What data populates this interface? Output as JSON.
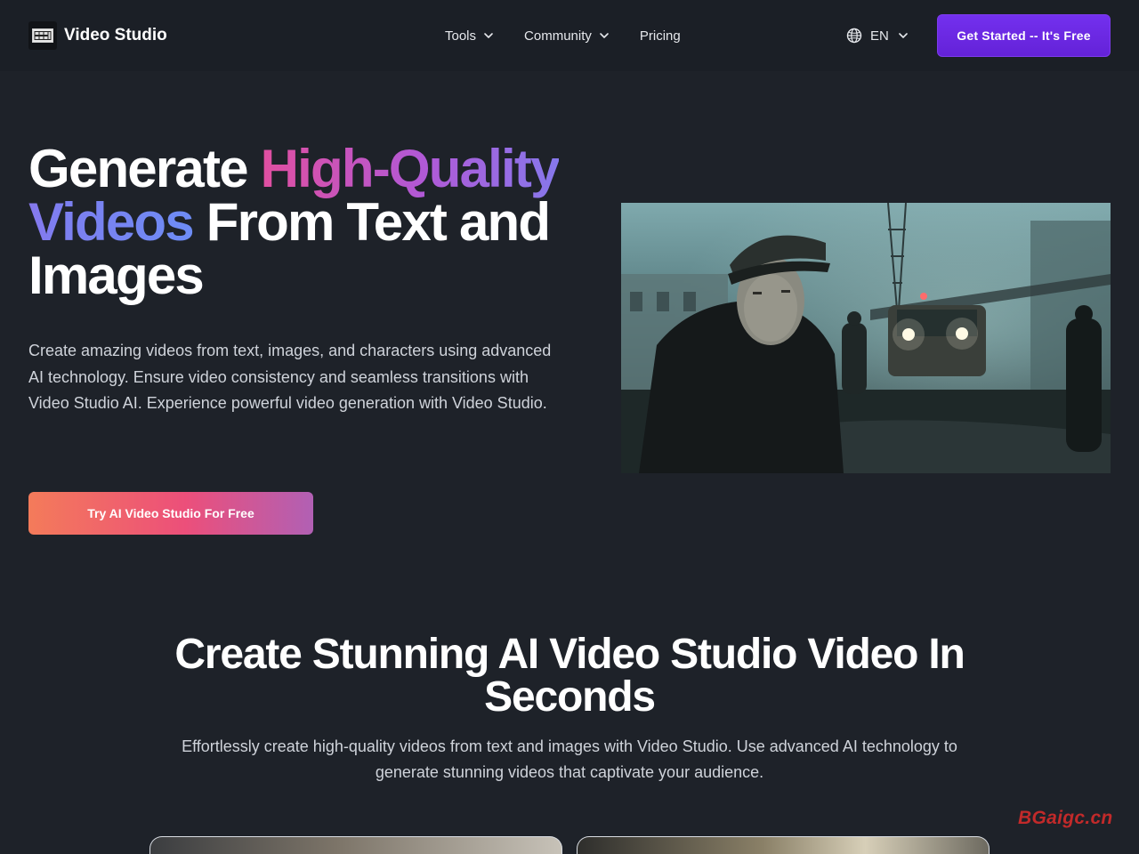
{
  "header": {
    "brand": {
      "name": "Video Studio",
      "logo_icon": "film-logo-icon"
    },
    "nav": [
      {
        "label": "Tools",
        "has_dropdown": true
      },
      {
        "label": "Community",
        "has_dropdown": true
      },
      {
        "label": "Pricing",
        "has_dropdown": false
      }
    ],
    "language": {
      "label": "EN",
      "icon": "globe-icon"
    },
    "cta_label": "Get Started -- It's Free"
  },
  "hero": {
    "title_part1": "Generate ",
    "title_highlight": "High-Quality Videos",
    "title_part2": " From Text and Images",
    "description": "Create amazing videos from text, images, and characters using advanced AI technology. Ensure video consistency and seamless transitions with Video Studio AI. Experience powerful video generation with Video Studio.",
    "cta_label": "Try AI Video Studio For Free"
  },
  "section": {
    "title": "Create Stunning AI Video Studio Video In Seconds",
    "description": "Effortlessly create high-quality videos from text and images with Video Studio. Use advanced AI technology to generate stunning videos that captivate your audience."
  },
  "watermark": "BGaigc.cn",
  "colors": {
    "background": "#1e2229",
    "header_bg": "#1b1f26",
    "primary_button": "#6d28d9",
    "gradient_start": "#f47b5a",
    "gradient_end": "#b160b4",
    "watermark": "#c22a2a"
  }
}
